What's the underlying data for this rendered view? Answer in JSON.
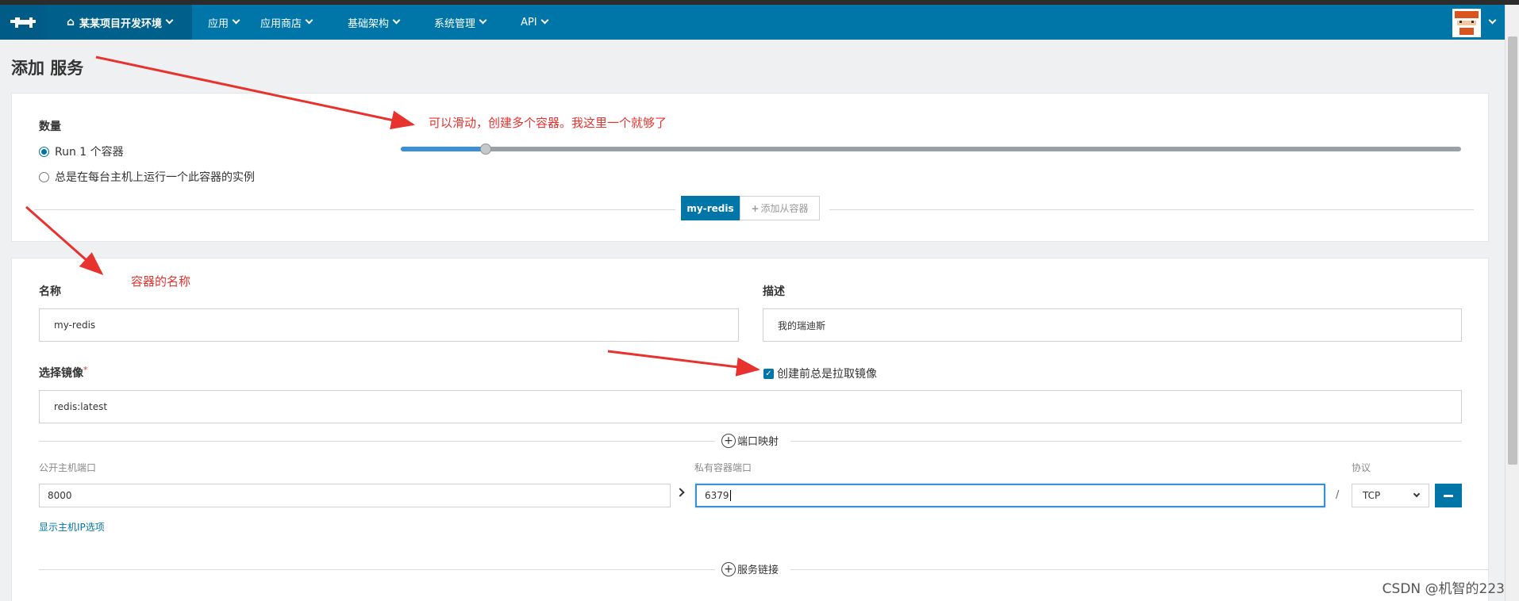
{
  "header": {
    "environment": "某某项目开发环境",
    "nav": [
      "应用",
      "应用商店",
      "基础架构",
      "系统管理",
      "API"
    ]
  },
  "page": {
    "title": "添加 服务"
  },
  "scale": {
    "label": "数量",
    "run_option": "Run 1 个容器",
    "always_option": "总是在每台主机上运行一个此容器的实例",
    "slider_level": 0.08,
    "containers": [
      "my-redis"
    ],
    "add_sidekick": "添加从容器"
  },
  "service": {
    "name_label": "名称",
    "name_value": "my-redis",
    "desc_label": "描述",
    "desc_value": "我的瑞迪斯",
    "image_label": "选择镜像",
    "required_mark": "*",
    "image_value": "redis:latest",
    "pull_label": "创建前总是拉取镜像",
    "pull_checked": true
  },
  "ports": {
    "section_label": "端口映射",
    "public_label": "公开主机端口",
    "private_label": "私有容器端口",
    "protocol_label": "协议",
    "public_value": "8000",
    "private_value": "6379",
    "separator": "/",
    "protocol_value": "TCP",
    "show_ip_link": "显示主机IP选项"
  },
  "links": {
    "section_label": "服务链接"
  },
  "annotations": {
    "slider_note": "可以滑动，创建多个容器。我这里一个就够了",
    "name_note": "容器的名称"
  },
  "watermark": "CSDN @机智的223",
  "colors": {
    "header": "#0075a8",
    "accent": "#0075a8",
    "note": "#e8322e"
  }
}
